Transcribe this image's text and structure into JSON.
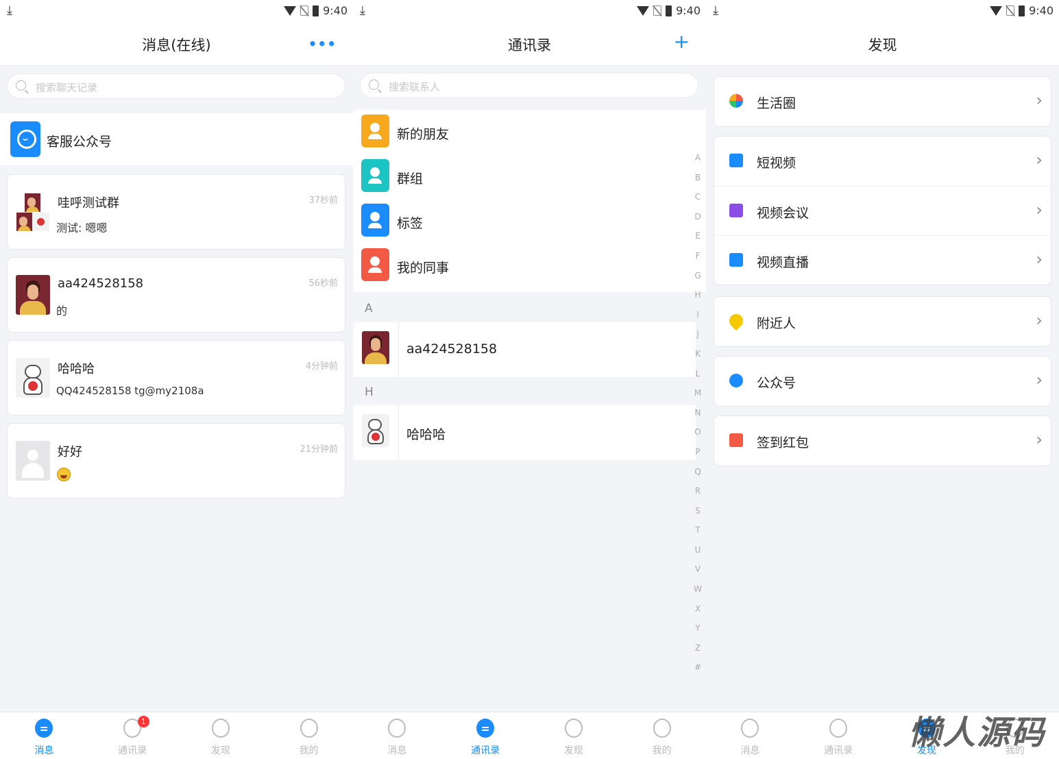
{
  "status_bar": {
    "time": "9:40"
  },
  "messages_screen": {
    "title": "消息(在线)",
    "more_icon": "more-dots-icon",
    "search_placeholder": "搜索聊天记录",
    "official_account": {
      "label": "客服公众号"
    },
    "conversations": [
      {
        "name": "哇呼测试群",
        "preview": "测试: 嗯嗯",
        "time": "37秒前"
      },
      {
        "name": "aa424528158",
        "preview": "的",
        "time": "56秒前"
      },
      {
        "name": "哈哈哈",
        "preview": "QQ424528158 tg@my2108a",
        "time": "4分钟前"
      },
      {
        "name": "好好",
        "preview": "",
        "time": "21分钟前"
      }
    ]
  },
  "contacts_screen": {
    "title": "通讯录",
    "add_icon": "plus-icon",
    "search_placeholder": "搜索联系人",
    "menu": [
      {
        "label": "新的朋友",
        "color": "#f7a81c"
      },
      {
        "label": "群组",
        "color": "#1cc4c4"
      },
      {
        "label": "标签",
        "color": "#1a8cff"
      },
      {
        "label": "我的同事",
        "color": "#f25a46"
      }
    ],
    "sections": [
      {
        "letter": "A",
        "contacts": [
          "aa424528158"
        ]
      },
      {
        "letter": "H",
        "contacts": [
          "哈哈哈"
        ]
      }
    ],
    "index_letters": [
      "A",
      "B",
      "C",
      "D",
      "E",
      "F",
      "G",
      "H",
      "I",
      "J",
      "K",
      "L",
      "M",
      "N",
      "O",
      "P",
      "Q",
      "R",
      "S",
      "T",
      "U",
      "V",
      "W",
      "X",
      "Y",
      "Z",
      "#"
    ]
  },
  "discover_screen": {
    "title": "发现",
    "groups": [
      [
        {
          "label": "生活圈",
          "icon": "pinwheel-icon"
        }
      ],
      [
        {
          "label": "短视频",
          "icon": "play-icon"
        },
        {
          "label": "视频会议",
          "icon": "meeting-icon"
        },
        {
          "label": "视频直播",
          "icon": "live-icon"
        }
      ],
      [
        {
          "label": "附近人",
          "icon": "location-pin-icon"
        }
      ],
      [
        {
          "label": "公众号",
          "icon": "verified-badge-icon"
        }
      ],
      [
        {
          "label": "签到红包",
          "icon": "red-packet-icon"
        }
      ]
    ]
  },
  "tabbar": {
    "tabs": [
      "消息",
      "通讯录",
      "发现",
      "我的"
    ],
    "contacts_badge": "1"
  },
  "watermark": "懒人源码"
}
